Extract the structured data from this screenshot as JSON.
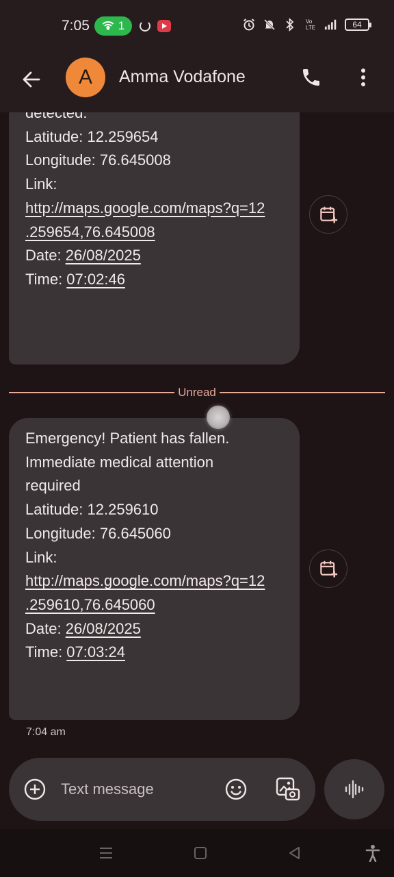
{
  "status_bar": {
    "time": "7:05",
    "hotspot_count": "1",
    "battery": "64",
    "icons": [
      "hotspot-icon",
      "sync-icon",
      "screen-record-icon",
      "alarm-icon",
      "mute-icon",
      "bluetooth-icon",
      "volte-icon",
      "signal-icon",
      "battery-icon"
    ]
  },
  "header": {
    "avatar_letter": "A",
    "contact_name": "Amma Vodafone",
    "icons": [
      "back-arrow-icon",
      "phone-icon",
      "more-vert-icon"
    ]
  },
  "messages": [
    {
      "lines": [
        {
          "text": "detected."
        },
        {
          "text": "Latitude: 12.259654"
        },
        {
          "text": "Longitude: 76.645008"
        },
        {
          "text": "Link:"
        },
        {
          "link": "http://maps.google.com/maps?q=12"
        },
        {
          "link": ".259654,76.645008"
        },
        {
          "text": "Date: ",
          "link": "26/08/2025"
        },
        {
          "text": "Time: ",
          "link": "07:02:46"
        }
      ]
    },
    {
      "lines": [
        {
          "text": "Emergency! Patient has fallen."
        },
        {
          "text": "Immediate medical attention"
        },
        {
          "text": "required"
        },
        {
          "text": "Latitude: 12.259610"
        },
        {
          "text": "Longitude: 76.645060"
        },
        {
          "text": "Link:"
        },
        {
          "link": "http://maps.google.com/maps?q=12"
        },
        {
          "link": ".259610,76.645060"
        },
        {
          "text": "Date: ",
          "link": "26/08/2025"
        },
        {
          "text": "Time: ",
          "link": "07:03:24"
        }
      ],
      "timestamp": "7:04 am"
    }
  ],
  "unread_label": "Unread",
  "compose": {
    "placeholder": "Text message"
  },
  "accent_colors": {
    "avatar": "#f0883a",
    "unread": "#e9a898",
    "hotspot": "#2db84d"
  }
}
